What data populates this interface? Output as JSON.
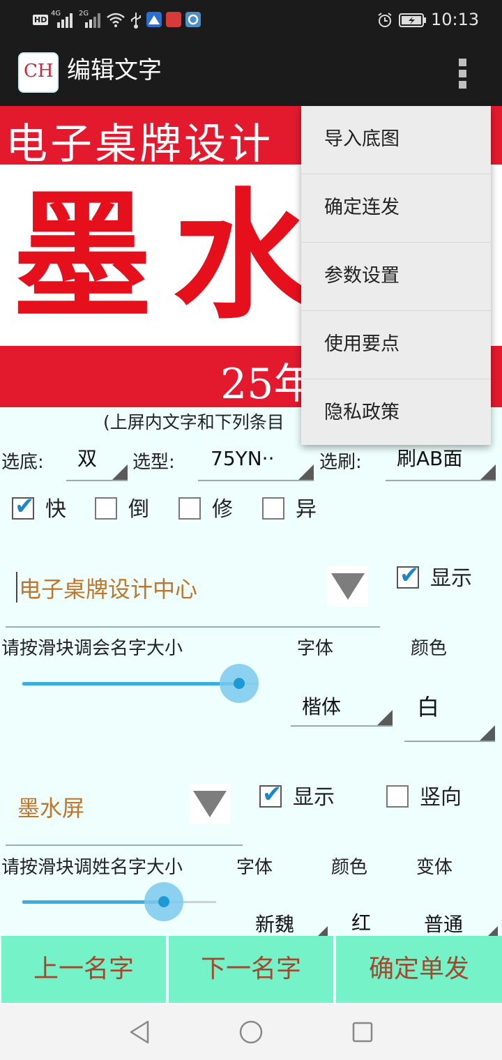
{
  "status_bar": {
    "time": "10:13",
    "net1": "4G",
    "net2": "2G",
    "sim_badge": "HD",
    "icons": [
      "hd-icon",
      "signal-4g-icon",
      "signal-2g-icon",
      "wifi-icon",
      "usb-icon",
      "app-notification-icon",
      "huawei-notification-icon",
      "app-notification-icon",
      "alarm-icon",
      "battery-charging-icon"
    ]
  },
  "app_bar": {
    "title": "编辑文字",
    "logo_letters": "CH",
    "overflow_icon": "more-vertical-icon"
  },
  "banner": {
    "top_text": "电子桌牌设计",
    "big_text": "墨水",
    "bottom_text": "25年",
    "colors": {
      "red": "#e31a2e",
      "white": "#ffffff"
    }
  },
  "hint": "(上屏内文字和下列条目",
  "options": {
    "base_label": "选底:",
    "base_value": "双",
    "model_label": "选型:",
    "model_value": "75YN··",
    "brush_label": "选刷:",
    "brush_value": "刷AB面"
  },
  "checkboxes": [
    {
      "label": "快",
      "checked": true
    },
    {
      "label": "倒",
      "checked": false
    },
    {
      "label": "修",
      "checked": false
    },
    {
      "label": "异",
      "checked": false
    }
  ],
  "field1": {
    "value": "电子桌牌设计中心",
    "show_label": "显示",
    "show_checked": true,
    "slider_label": "请按滑块调会名字大小",
    "font_label": "字体",
    "color_label": "颜色",
    "font_value": "楷体",
    "color_value": "白",
    "slider_value": 0.86
  },
  "field2": {
    "value": "墨水屏",
    "show_label": "显示",
    "show_checked": true,
    "vertical_label": "竖向",
    "vertical_checked": false,
    "slider_label": "请按滑块调姓名字大小",
    "font_label": "字体",
    "color_label": "颜色",
    "variant_label": "变体",
    "font_value": "新魏",
    "color_value": "红",
    "variant_value": "普通",
    "slider_value": 0.73
  },
  "buttons": {
    "prev": "上一名字",
    "next": "下一名字",
    "confirm": "确定单发"
  },
  "menu": {
    "items": [
      "导入底图",
      "确定连发",
      "参数设置",
      "使用要点",
      "隐私政策"
    ]
  },
  "nav": [
    "back-icon",
    "home-icon",
    "recents-icon"
  ]
}
